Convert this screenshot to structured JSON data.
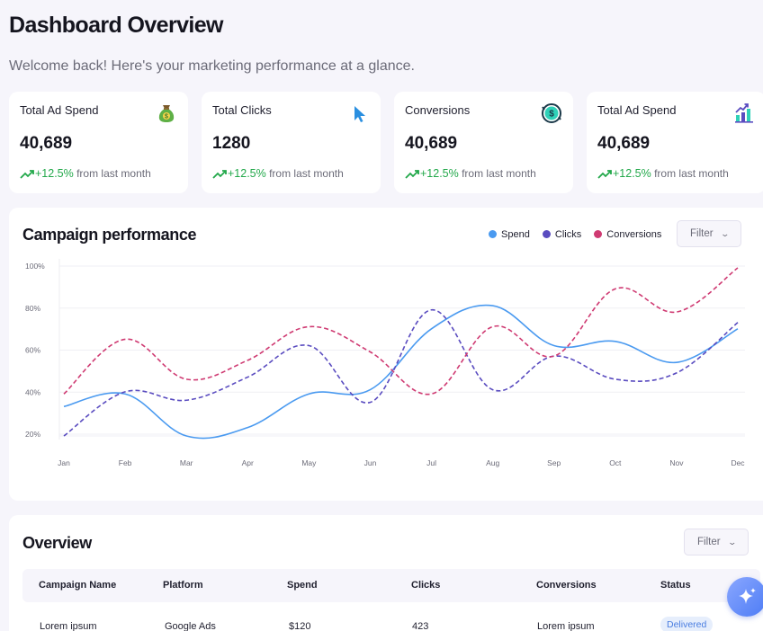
{
  "page": {
    "title": "Dashboard Overview",
    "subtitle": "Welcome back! Here's your marketing performance at a glance."
  },
  "cards": [
    {
      "label": "Total Ad Spend",
      "value": "40,689",
      "change": "+12.5%",
      "change_note": "from last month",
      "icon": "money-bag-icon"
    },
    {
      "label": "Total Clicks",
      "value": "1280",
      "change": "+12.5%",
      "change_note": "from last month",
      "icon": "cursor-icon"
    },
    {
      "label": "Conversions",
      "value": "40,689",
      "change": "+12.5%",
      "change_note": "from last month",
      "icon": "dollar-cycle-icon"
    },
    {
      "label": "Total Ad Spend",
      "value": "40,689",
      "change": "+12.5%",
      "change_note": "from last month",
      "icon": "bar-chart-growth-icon"
    }
  ],
  "colors": {
    "accent_green": "#22a84a",
    "spend": "#4a9af0",
    "clicks": "#5a4cc0",
    "conversions": "#cf3a72",
    "fab": "#4d7cf5"
  },
  "campaign": {
    "title": "Campaign performance",
    "filter_label": "Filter"
  },
  "chart_data": {
    "type": "line",
    "categories": [
      "Jan",
      "Feb",
      "Mar",
      "Apr",
      "May",
      "Jun",
      "Jul",
      "Aug",
      "Sep",
      "Oct",
      "Nov",
      "Dec"
    ],
    "y_ticks": [
      "20%",
      "40%",
      "60%",
      "80%",
      "100%"
    ],
    "ylim": [
      20,
      100
    ],
    "grid": true,
    "legend_position": "top-right",
    "series": [
      {
        "name": "Spend",
        "color": "#4a9af0",
        "style": "solid",
        "values": [
          34,
          40,
          20,
          24,
          40,
          42,
          71,
          82,
          63,
          65,
          55,
          71
        ]
      },
      {
        "name": "Clicks",
        "color": "#5a4cc0",
        "style": "dashed",
        "values": [
          20,
          41,
          37,
          48,
          63,
          36,
          80,
          42,
          58,
          47,
          50,
          74
        ]
      },
      {
        "name": "Conversions",
        "color": "#cf3a72",
        "style": "dashed",
        "values": [
          40,
          66,
          47,
          56,
          72,
          60,
          40,
          72,
          58,
          90,
          79,
          100
        ]
      }
    ]
  },
  "overview": {
    "title": "Overview",
    "filter_label": "Filter",
    "columns": [
      "Campaign Name",
      "Platform",
      "Spend",
      "Clicks",
      "Conversions",
      "Status"
    ],
    "rows": [
      [
        "Lorem ipsum",
        "Google Ads",
        "$120",
        "423",
        "Lorem ipsum",
        "Delivered"
      ]
    ]
  },
  "fab": {
    "icon": "sparkle-icon"
  }
}
